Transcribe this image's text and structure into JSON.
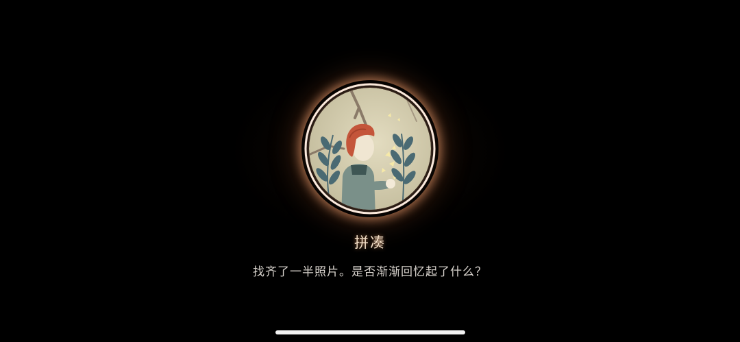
{
  "achievement": {
    "title": "拼凑",
    "description": "找齐了一半照片。是否渐渐回忆起了什么？",
    "badge_icon": "boy-with-butterflies-badge-icon"
  },
  "colors": {
    "background": "#000000",
    "badge_ring": "#fbe9dc",
    "badge_glow": "#e89a6a",
    "badge_fill": "#cdc6a9",
    "hair": "#c4553a",
    "jacket": "#7a9089",
    "leaves": "#4a6a73",
    "title_text": "#f3dfc8",
    "description_text": "#d9d4ce"
  }
}
